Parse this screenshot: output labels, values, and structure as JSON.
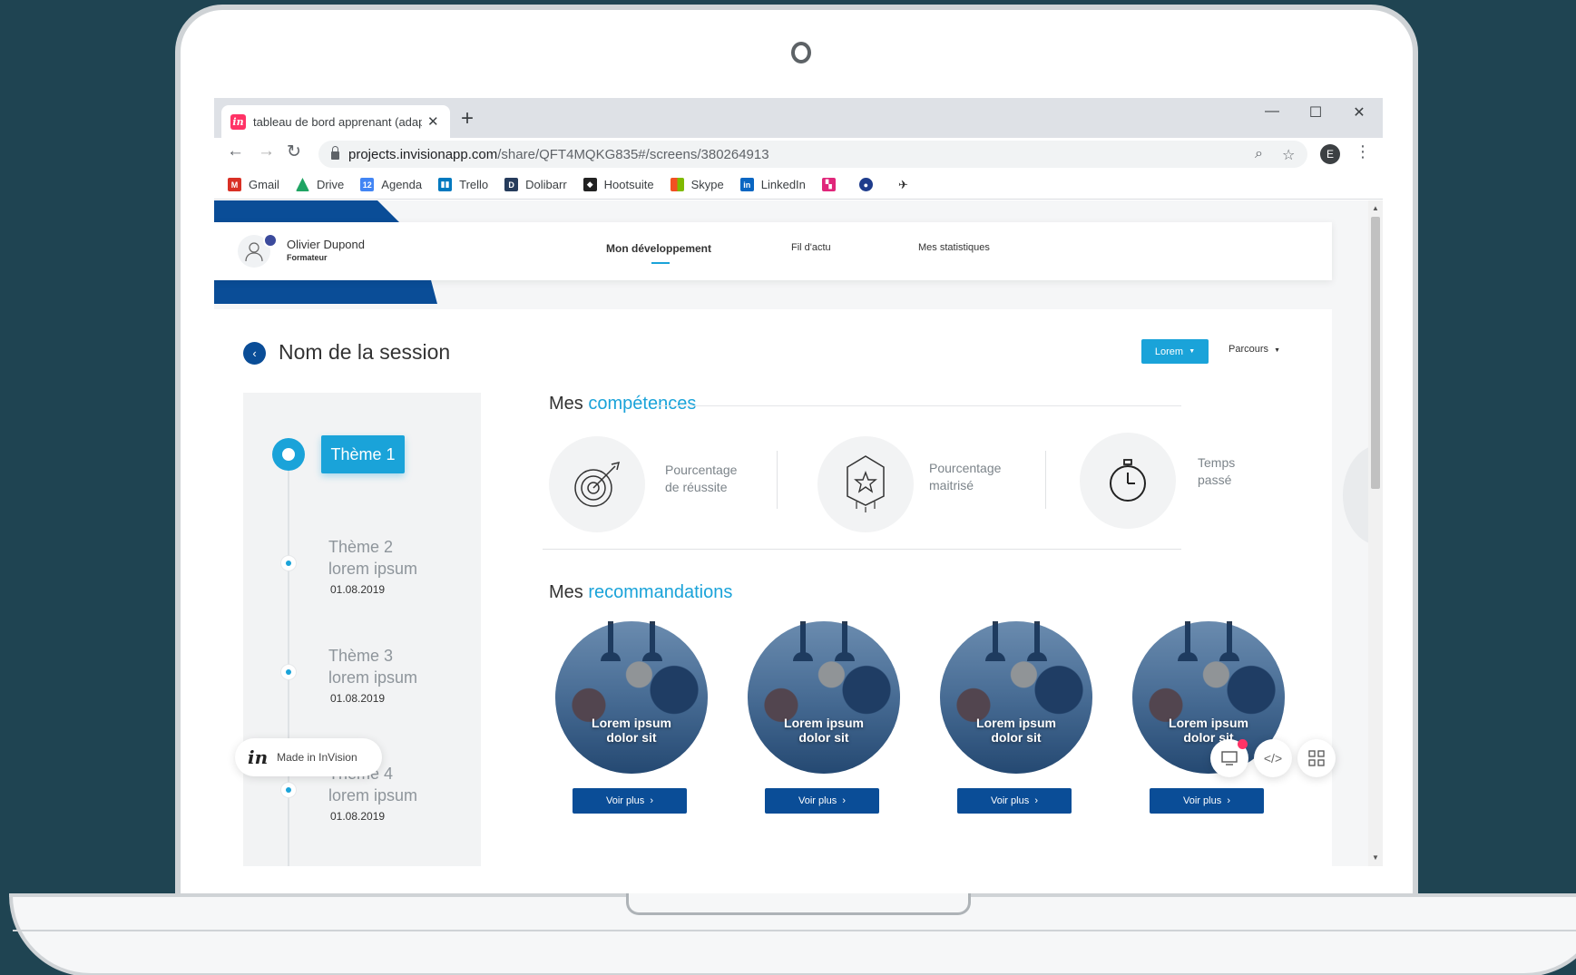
{
  "browser": {
    "tab_title": "tableau de bord apprenant (adap",
    "url_host": "projects.invisionapp.com",
    "url_path": "/share/QFT4MQKG835#/screens/380264913",
    "profile_initial": "E",
    "bookmarks": [
      {
        "label": "Gmail",
        "icon": "gmail-icon",
        "color": "#d93025"
      },
      {
        "label": "Drive",
        "icon": "drive-icon",
        "color": "#1fa463"
      },
      {
        "label": "Agenda",
        "icon": "calendar-icon",
        "color": "#4285f4"
      },
      {
        "label": "Trello",
        "icon": "trello-icon",
        "color": "#0079bf"
      },
      {
        "label": "Dolibarr",
        "icon": "dolibarr-icon",
        "color": "#263c5c"
      },
      {
        "label": "Hootsuite",
        "icon": "hootsuite-icon",
        "color": "#222222"
      },
      {
        "label": "Skype",
        "icon": "microsoft-icon",
        "color": "#f25022"
      },
      {
        "label": "LinkedIn",
        "icon": "linkedin-icon",
        "color": "#0a66c2"
      }
    ]
  },
  "user": {
    "name": "Olivier Dupond",
    "role": "Formateur"
  },
  "nav": {
    "items": [
      "Mon développement",
      "Fil d'actu",
      "Mes statistiques"
    ],
    "active": "Mon développement"
  },
  "session": {
    "title": "Nom de la session",
    "dropdown_primary": "Lorem",
    "dropdown_secondary": "Parcours"
  },
  "timeline": {
    "active_theme": "Thème 1",
    "items": [
      {
        "theme": "Thème 2",
        "subtitle": "lorem ipsum",
        "date": "01.08.2019"
      },
      {
        "theme": "Thème 3",
        "subtitle": "lorem ipsum",
        "date": "01.08.2019"
      },
      {
        "theme": "Thème 4",
        "subtitle": "lorem ipsum",
        "date": "01.08.2019"
      }
    ]
  },
  "competences": {
    "title_prefix": "Mes",
    "title_accent": "compétences",
    "stats": [
      {
        "line1": "Pourcentage",
        "line2": "de réussite",
        "icon": "target-icon"
      },
      {
        "line1": "Pourcentage",
        "line2": "maitrisé",
        "icon": "badge-star-icon"
      },
      {
        "line1": "Temps",
        "line2": "passé",
        "icon": "stopwatch-icon"
      }
    ]
  },
  "recommandations": {
    "title_prefix": "Mes",
    "title_accent": "recommandations",
    "cards": [
      {
        "line1": "Lorem ipsum",
        "line2": "dolor sit",
        "button": "Voir plus"
      },
      {
        "line1": "Lorem ipsum",
        "line2": "dolor sit",
        "button": "Voir plus"
      },
      {
        "line1": "Lorem ipsum",
        "line2": "dolor sit",
        "button": "Voir plus"
      },
      {
        "line1": "Lorem ipsum",
        "line2": "dolor sit",
        "button": "Voir plus"
      }
    ]
  },
  "invision": {
    "made_in": "Made in InVision"
  },
  "colors": {
    "accent": "#1aa3d9",
    "brand_blue": "#0a4d97",
    "background": "#1f4452"
  }
}
